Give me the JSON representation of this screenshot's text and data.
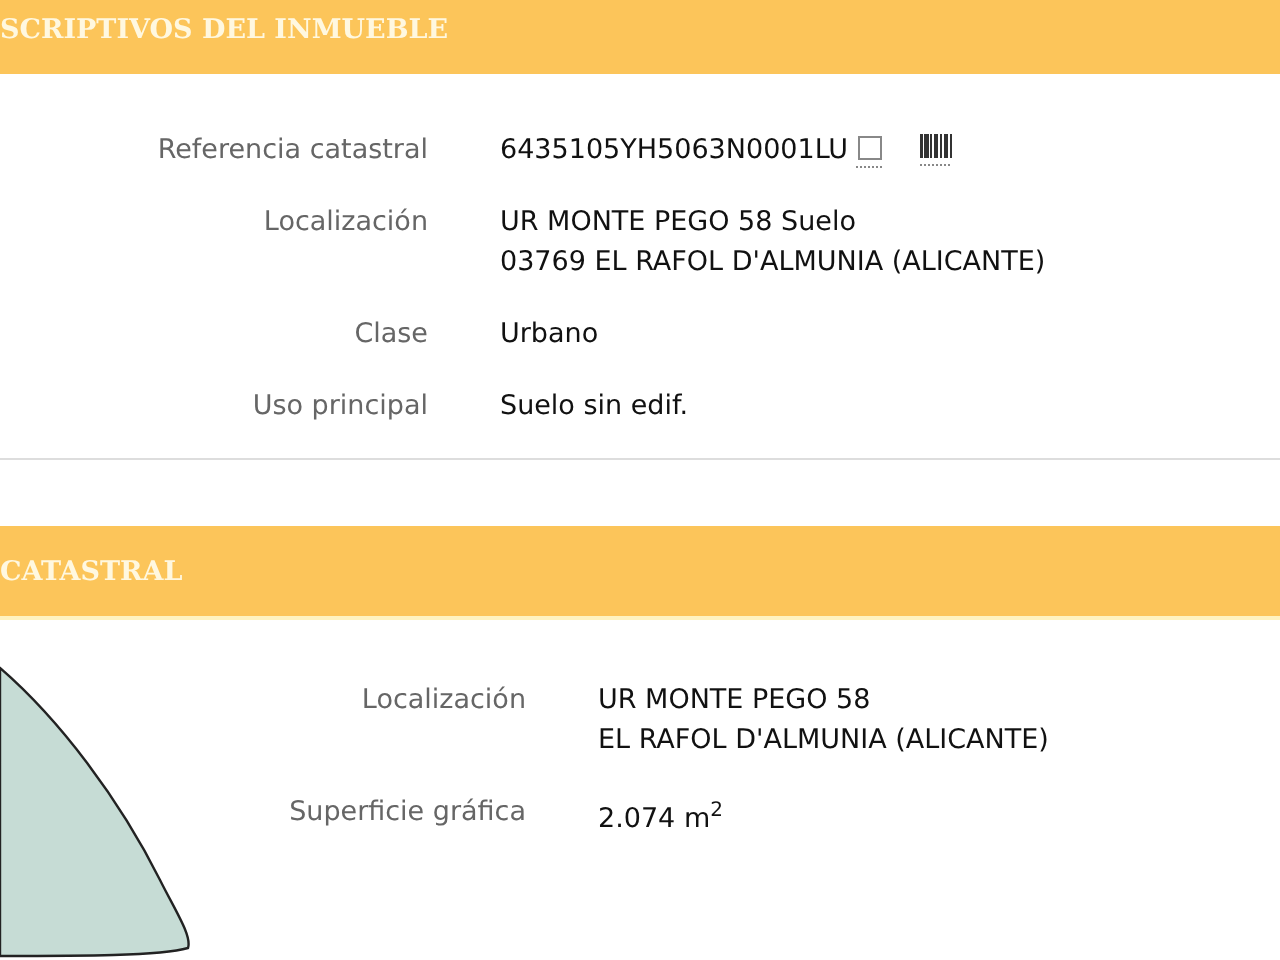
{
  "sections": [
    {
      "title": "SCRIPTIVOS DEL INMUEBLE",
      "kind": "details",
      "rows": [
        {
          "label": "Referencia catastral",
          "lines": [
            "6435105YH5063N0001LU"
          ],
          "icons": true
        },
        {
          "label": "Localización",
          "lines": [
            "UR MONTE PEGO 58 Suelo",
            "03769 EL RAFOL D'ALMUNIA (ALICANTE)"
          ]
        },
        {
          "label": "Clase",
          "lines": [
            "Urbano"
          ]
        },
        {
          "label": "Uso principal",
          "lines": [
            "Suelo sin edif."
          ]
        }
      ]
    },
    {
      "title": "CATASTRAL",
      "kind": "map",
      "rows": [
        {
          "label": "Localización",
          "lines": [
            "UR MONTE PEGO 58",
            "EL RAFOL D'ALMUNIA (ALICANTE)"
          ]
        },
        {
          "label": "Superficie gráfica",
          "lines": [
            "2.074 m$^{2}$"
          ]
        }
      ]
    }
  ]
}
